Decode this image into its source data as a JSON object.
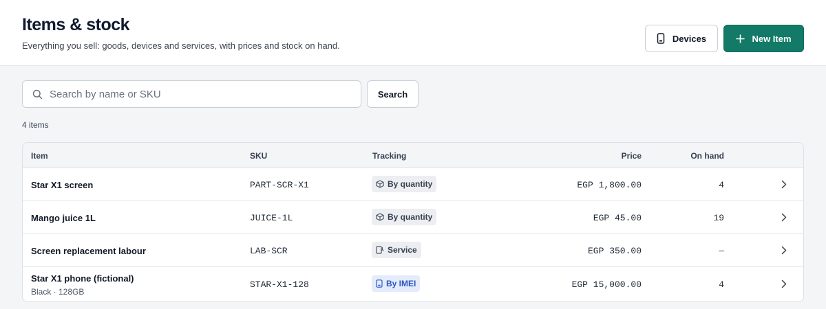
{
  "header": {
    "title": "Items & stock",
    "subtitle": "Everything you sell: goods, devices and services, with prices and stock on hand.",
    "devices_label": "Devices",
    "new_item_label": "New Item",
    "accent_color": "#127a66"
  },
  "search": {
    "placeholder": "Search by name or SKU",
    "value": "",
    "button_label": "Search"
  },
  "count_label": "4 items",
  "table": {
    "columns": [
      "Item",
      "SKU",
      "Tracking",
      "Price",
      "On hand"
    ],
    "rows": [
      {
        "name": "Star X1 screen",
        "variant": "",
        "sku": "PART-SCR-X1",
        "tracking": "By quantity",
        "tracking_icon": "box-icon",
        "price": "EGP 1,800.00",
        "on_hand": "4"
      },
      {
        "name": "Mango juice 1L",
        "variant": "",
        "sku": "JUICE-1L",
        "tracking": "By quantity",
        "tracking_icon": "box-icon",
        "price": "EGP 45.00",
        "on_hand": "19"
      },
      {
        "name": "Screen replacement labour",
        "variant": "",
        "sku": "LAB-SCR",
        "tracking": "Service",
        "tracking_icon": "service-icon",
        "price": "EGP 350.00",
        "on_hand": "—"
      },
      {
        "name": "Star X1 phone (fictional)",
        "variant": "Black · 128GB",
        "sku": "STAR-X1-128",
        "tracking": "By IMEI",
        "tracking_icon": "phone-icon",
        "price": "EGP 15,000.00",
        "on_hand": "4"
      }
    ]
  }
}
